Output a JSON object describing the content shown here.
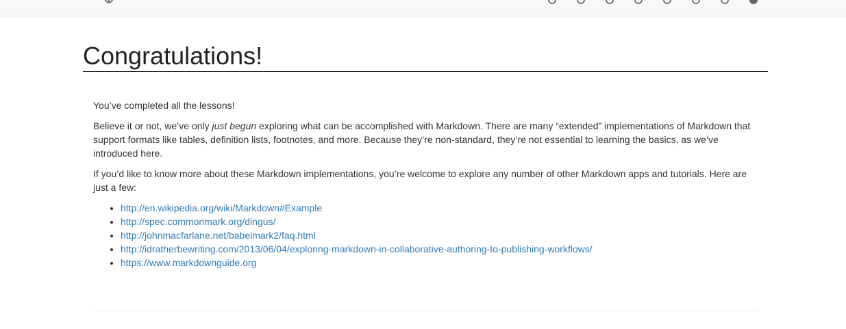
{
  "nav": {
    "logo_icon": "markdown-logo-icon",
    "lesson_dots": [
      {
        "active": false
      },
      {
        "active": false
      },
      {
        "active": false
      },
      {
        "active": false
      },
      {
        "active": false
      },
      {
        "active": false
      },
      {
        "active": false
      },
      {
        "active": true
      }
    ]
  },
  "page": {
    "title": "Congratulations!",
    "p1": "You’ve completed all the lessons!",
    "p2_before": "Believe it or not, we’ve only ",
    "p2_em": "just begun",
    "p2_after": " exploring what can be accomplished with Markdown. There are many “extended” implementations of Markdown that support formats like tables, definition lists, footnotes, and more. Because they’re non-standard, they’re not essential to learning the basics, as we’ve introduced here.",
    "p3": "If you’d like to know more about these Markdown implementations, you’re welcome to explore any number of other Markdown apps and tutorials. Here are just a few:",
    "links": [
      "http://en.wikipedia.org/wiki/Markdown#Example",
      "http://spec.commonmark.org/dingus/",
      "http://johnmacfarlane.net/babelmark2/faq.html",
      "http://idratherbewriting.com/2013/06/04/exploring-markdown-in-collaborative-authoring-to-publishing-workflows/",
      "https://www.markdownguide.org"
    ]
  },
  "colors": {
    "link": "#337ab7",
    "text": "#333333",
    "topbar": "#f8f8f8"
  }
}
